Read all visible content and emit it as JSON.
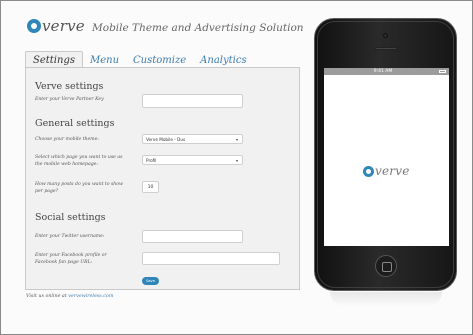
{
  "brand": {
    "logo_text": "verve",
    "tagline": "Mobile Theme and Advertising Solution"
  },
  "tabs": [
    {
      "label": "Settings",
      "active": true
    },
    {
      "label": "Menu",
      "active": false
    },
    {
      "label": "Customize",
      "active": false
    },
    {
      "label": "Analytics",
      "active": false
    }
  ],
  "verve_settings": {
    "title": "Verve settings",
    "partner_key_label": "Enter your Verve Partner Key",
    "partner_key_value": ""
  },
  "general_settings": {
    "title": "General settings",
    "theme_label": "Choose your mobile theme:",
    "theme_value": "Verve Mobile - Dus",
    "homepage_label": "Select which page you want to use as the mobile web homepage:",
    "homepage_value": "Profil",
    "posts_label": "How many posts do you want to show per page?",
    "posts_value": "10"
  },
  "social_settings": {
    "title": "Social settings",
    "twitter_label": "Enter your Twitter username:",
    "twitter_value": "",
    "facebook_label": "Enter your Facebook profile or Facebook fan page URL:",
    "facebook_value": ""
  },
  "save_label": "Save",
  "footer": {
    "visit_text": "Visit us online at",
    "visit_link": "vervewireless.com"
  },
  "phone": {
    "carrier": "",
    "time": "9:41 AM",
    "screen_logo_text": "verve"
  },
  "colors": {
    "accent": "#2f86b8",
    "tab_text": "#3a7cb0"
  }
}
